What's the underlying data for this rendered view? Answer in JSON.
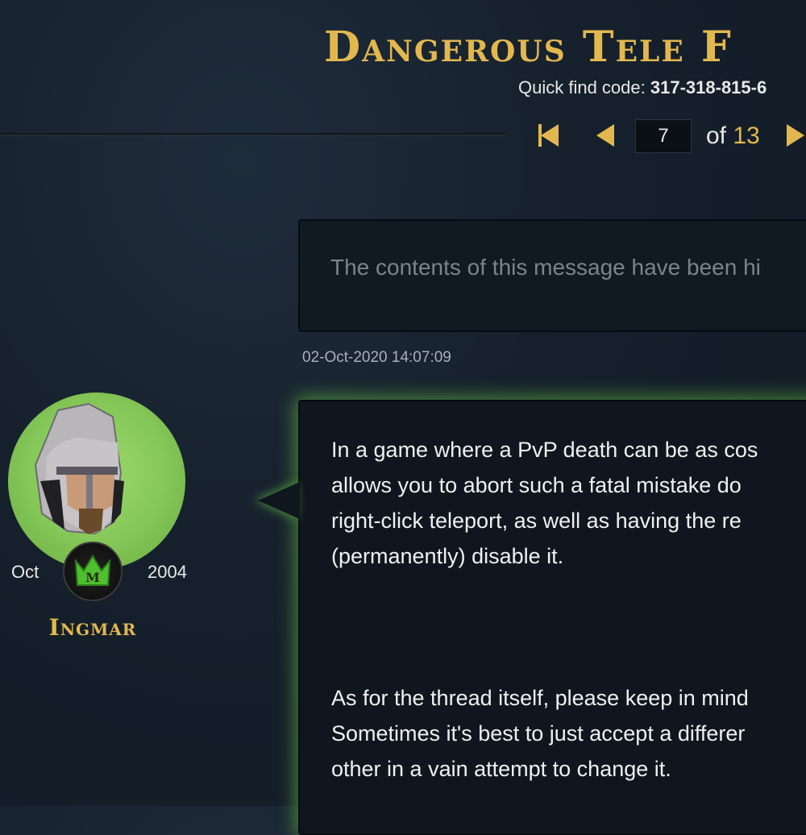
{
  "thread": {
    "title": "Dangerous Tele F",
    "quick_find_label": "Quick find code:",
    "quick_find_code": "317-318-815-6"
  },
  "pagination": {
    "current_page": "7",
    "of_label": "of",
    "total_pages": "13"
  },
  "posts": [
    {
      "hidden_message": "The contents of this message have been hi",
      "timestamp": "02-Oct-2020 14:07:09"
    },
    {
      "author": {
        "name": "Ingmar",
        "joined_month": "Oct",
        "joined_year": "2004",
        "badge_letter": "M"
      },
      "body": [
        [
          "In a game where a PvP death can be as cos",
          "allows you to abort such a fatal mistake do",
          "right-click teleport, as well as having the re",
          "(permanently) disable it."
        ],
        [
          "As for the thread itself, please keep in mind",
          "Sometimes it's best to just accept a differer",
          "other in a vain attempt to change it."
        ]
      ]
    }
  ],
  "colors": {
    "accent_gold": "#e2b84e",
    "glow_green": "#6ed246",
    "background": "#16202c"
  },
  "icons": [
    "first-page-icon",
    "prev-page-icon",
    "next-page-icon",
    "crown-badge-icon",
    "avatar-helmet-icon"
  ]
}
